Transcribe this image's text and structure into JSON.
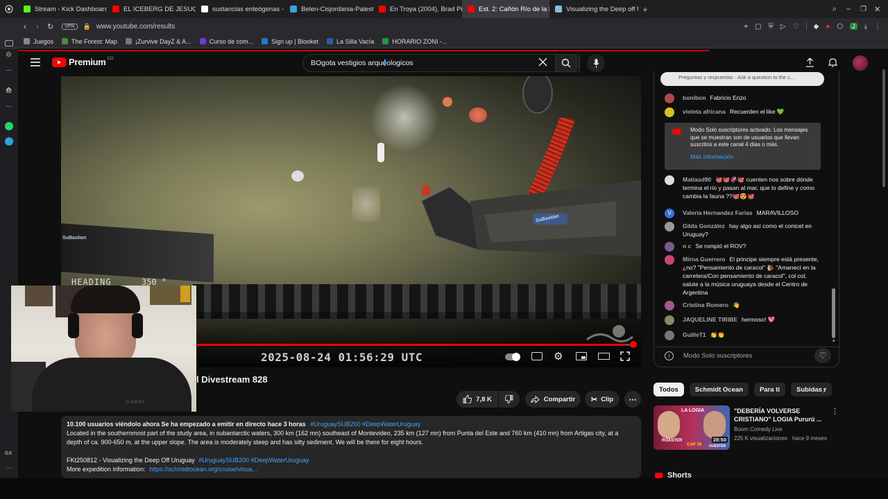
{
  "browser": {
    "tabs": [
      {
        "label": "Stream - Kick Dashboard",
        "color": "#53fc18",
        "glyph": "K"
      },
      {
        "label": "EL ICEBERG DE JESUCRI",
        "color": "#ff0000",
        "glyph": "▶"
      },
      {
        "label": "sustancias enteógenas -",
        "color": "#ffffff",
        "glyph": "G"
      },
      {
        "label": "Belen-Cisjordania-Palesti",
        "color": "#3aa0e0",
        "glyph": "W"
      },
      {
        "label": "En Troya (2004), Brad Pi",
        "color": "#ff0000",
        "glyph": "▶"
      },
      {
        "label": "Est. 2: Cañón Río de la Pl",
        "color": "#ff0000",
        "glyph": "▶",
        "active": true
      },
      {
        "label": "Visualizing the Deep off U",
        "color": "#8bd",
        "glyph": "✦"
      }
    ],
    "vpn_label": "VPN",
    "url": "www.youtube.com/results",
    "bookmarks": [
      {
        "label": "Juegos",
        "color": "#888"
      },
      {
        "label": "The Forest: Map",
        "color": "#4a8f3a"
      },
      {
        "label": "¡Zurvive DayZ & A...",
        "color": "#777"
      },
      {
        "label": "Curso de com...",
        "color": "#6a3cd8"
      },
      {
        "label": "Sign up | Blooket",
        "color": "#1c7bd6"
      },
      {
        "label": "La Silla Vacía",
        "color": "#2a5db0"
      },
      {
        "label": "HORARIO ZONI -...",
        "color": "#1e9a4a"
      }
    ]
  },
  "youtube": {
    "logo_text": "Premium",
    "country": "CO",
    "search_value": "BOgota vestigios arqueologicos",
    "video": {
      "heading_label": "HEADING",
      "heading_value": "350 °",
      "timestamp": "2025-08-24 01:56:29 UTC",
      "sticker_1": "SuBastian",
      "sticker_2": "SuBastian",
      "progress_fraction": 0.98
    },
    "title_fragment": "l Divestream 828",
    "actions": {
      "likes": "7,8 K",
      "share": "Compartir",
      "clip": "Clip"
    },
    "description": {
      "line1_stats": "10.100 usuarios viéndolo ahora  Se ha empezado a emitir en directo hace 3 horas",
      "tags1": "#UruguaySUB200 #DeepWaterUruguay",
      "body": "Located in the southernmost part of the study area, in subantarctic waters, 300 km (162 mn) southeast of Montevideo, 235 km (127 mn) from Punta del Este and 760 km (410 mn) from Artigas city, at a depth of ca. 900-650 m, at the upper slope. The area is moderately steep and has silty sediment. We will be there for eight hours.",
      "fkt": "FKt250812 - Visualizing the Deep Off Uruguay",
      "tags2": "#UruguaySUB200 #DeepWaterUruguay",
      "more_label": "More expedition information:",
      "more_link": "https://schmidtocean.org/cruise/visua..."
    }
  },
  "chat": {
    "qa_text": "Preguntas y respuestas · Ask a question to the c...",
    "messages": [
      {
        "author": "bonibon",
        "text": "Fabricio Erizo",
        "avatar": "#b04a4a"
      },
      {
        "author": "violeta africana",
        "text": "Recuerden el like 💚",
        "avatar": "#d6c21e"
      },
      {
        "author": "Matiasd90",
        "text": "🐙🐙🦑🐙 cuenten nos sobre dónde termina el rio y pasan al mar, que lo define y como cambia la fauna ??🐙😍🐙",
        "avatar": "#ddd"
      },
      {
        "author": "Valeria Hernandez Farias",
        "text": "MARAVILLOSO",
        "avatar": "#3a6fd8",
        "initial": "V"
      },
      {
        "author": "Gilda González",
        "text": "hay algo así como el conicet en Uruguay?",
        "avatar": "#999"
      },
      {
        "author": "n c",
        "text": "Se rompió el ROV?",
        "avatar": "#7a5a8a"
      },
      {
        "author": "Mirna Guerrero",
        "text": "El principe siempre está presente, ¿no? \"Pensamiento de caracol\" 🐌 \"Amanecí en la carretera/Con pensamiento de caracol\", col col, salute a la música uruguaya desde el Centro de Argentina",
        "avatar": "#c47"
      },
      {
        "author": "Cristina Romero",
        "text": "👋",
        "avatar": "#a05a8a"
      },
      {
        "author": "JAQUELINE TIRIBE",
        "text": "hermoso! 💖",
        "avatar": "#886"
      },
      {
        "author": "GuilleT1",
        "text": "👏👏",
        "avatar": "#777"
      }
    ],
    "mode_notice": {
      "text": "Modo Solo suscriptores activado. Los mensajes que se muestran son de usuarios que llevan suscritos a este canal 4 días o más.",
      "link": "Más información"
    },
    "footer_text": "Modo Solo suscriptores"
  },
  "related": {
    "chips": [
      "Todos",
      "Schmidt Ocean",
      "Para ti",
      "Subidas r"
    ],
    "video": {
      "title": "\"DEBERÍA VOLVERSE CRISTIANO\" LOGIA Pururú ...",
      "channel": "Boom Comedy Live",
      "meta": "225 K visualizaciones · hace 9 meses",
      "duration": "28:50",
      "thumb_top": "LA LOGIA",
      "thumb_left": "ROASTER",
      "thumb_cap": "CAP 78",
      "thumb_right": "GUESTER"
    },
    "shorts_label": "Shorts"
  },
  "webcam": {
    "hoodie_text": "G KNVES"
  }
}
